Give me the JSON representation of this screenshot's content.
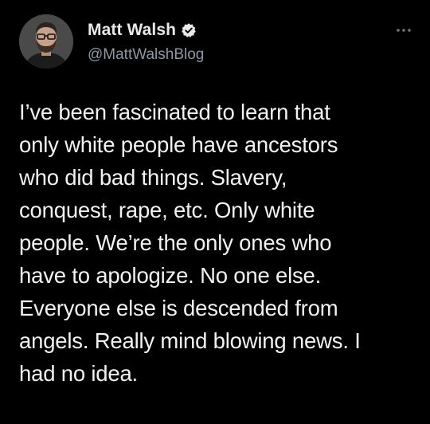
{
  "author": {
    "name": "Matt Walsh",
    "handle": "@MattWalshBlog",
    "verified": true,
    "verified_icon": "verified-badge-icon",
    "avatar": "profile-photo"
  },
  "menu_icon": "more-options-icon",
  "tweet": {
    "lines": [
      "I’ve been fascinated to learn that",
      "only white people have ancestors",
      "who did bad things. Slavery,",
      "conquest, rape, etc. Only white",
      "people. We’re the only ones who",
      "have to apologize. No one else.",
      "Everyone else is descended from",
      "angels. Really mind blowing news. I",
      "had no idea."
    ]
  },
  "colors": {
    "background": "#000000",
    "text": "#e7e9ea",
    "secondary_text": "#8b98a5"
  }
}
